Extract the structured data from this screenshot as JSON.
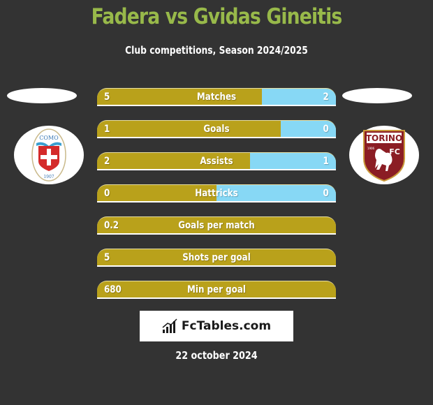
{
  "header": {
    "title": "Fadera vs Gvidas Gineitis",
    "subtitle": "Club competitions, Season 2024/2025"
  },
  "players": {
    "left": {
      "name": "Fadera",
      "club_logo": "como-1907-crest",
      "logo_text_top": "COMO",
      "logo_text_bottom": "1907"
    },
    "right": {
      "name": "Gvidas Gineitis",
      "club_logo": "torino-fc-crest",
      "logo_text_top": "TORINO",
      "logo_text_side": "FC",
      "logo_text_year": "1906"
    }
  },
  "colors": {
    "background": "#333333",
    "title": "#98b94a",
    "left_bar": "#b9a11b",
    "right_bar": "#87d8f5"
  },
  "stats": [
    {
      "label": "Matches",
      "left": "5",
      "right": "2",
      "right_share": 0.31
    },
    {
      "label": "Goals",
      "left": "1",
      "right": "0",
      "right_share": 0.23
    },
    {
      "label": "Assists",
      "left": "2",
      "right": "1",
      "right_share": 0.36
    },
    {
      "label": "Hattricks",
      "left": "0",
      "right": "0",
      "right_share": 0.5
    },
    {
      "label": "Goals per match",
      "left": "0.2",
      "right": "",
      "right_share": 0
    },
    {
      "label": "Shots per goal",
      "left": "5",
      "right": "",
      "right_share": 0
    },
    {
      "label": "Min per goal",
      "left": "680",
      "right": "",
      "right_share": 0
    }
  ],
  "brand": {
    "name": "FcTables.com",
    "icon": "bar-chart-icon"
  },
  "footer": {
    "date": "22 october 2024"
  }
}
